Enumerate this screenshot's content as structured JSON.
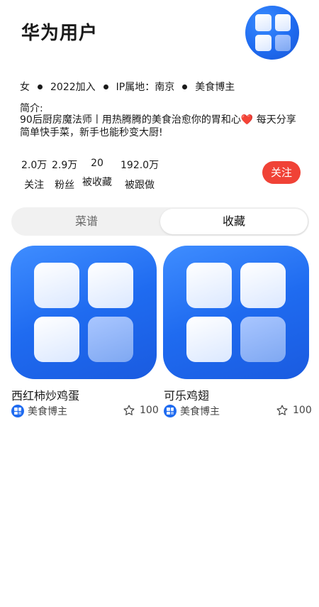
{
  "profile": {
    "name": "华为用户",
    "gender": "女",
    "joined": "2022加入",
    "ip_location": "IP属地：南京",
    "tag": "美食博主",
    "intro_label": "简介:",
    "intro_text": "90后厨房魔法师丨用热腾腾的美食治愈你的胃和心",
    "intro_emoji": "❤️",
    "intro_text2": " 每天分享简单快手菜，新手也能秒变大厨!"
  },
  "stats": [
    {
      "value": "2.0万",
      "label": "关注"
    },
    {
      "value": "2.9万",
      "label": "粉丝"
    },
    {
      "value": "20",
      "label": "被收藏"
    },
    {
      "value": "192.0万",
      "label": "被跟做"
    }
  ],
  "follow_button": "关注",
  "tabs": [
    {
      "label": "菜谱",
      "active": false
    },
    {
      "label": "收藏",
      "active": true
    }
  ],
  "cards": [
    {
      "title": "西红柿炒鸡蛋",
      "author": "美食博主",
      "likes": "100"
    },
    {
      "title": "可乐鸡翅",
      "author": "美食博主",
      "likes": "100"
    }
  ],
  "icons": {
    "avatar": "app-grid-icon",
    "like": "star-outline-icon"
  },
  "colors": {
    "accent": "#1f6bf0",
    "follow": "#f04236"
  }
}
